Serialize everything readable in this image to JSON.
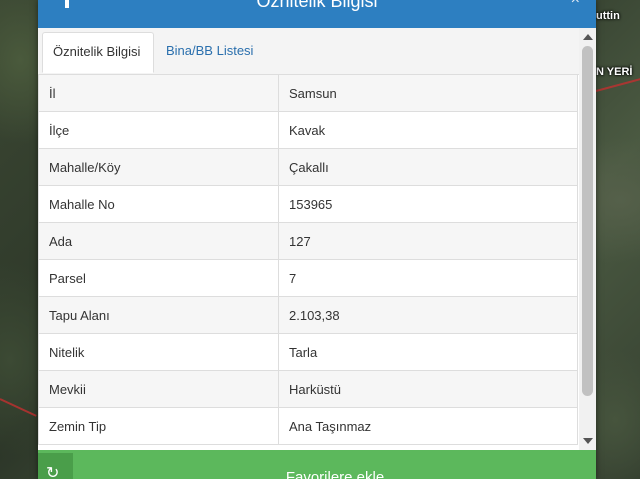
{
  "map": {
    "labels": [
      "uttin",
      "N YERİ"
    ]
  },
  "dialog": {
    "title": "Öznitelik Bilgisi",
    "close_symbol": "×",
    "tabs": [
      {
        "label": "Öznitelik Bilgisi",
        "active": true
      },
      {
        "label": "Bina/BB Listesi",
        "active": false
      }
    ],
    "rows": [
      {
        "key": "İl",
        "value": "Samsun"
      },
      {
        "key": "İlçe",
        "value": "Kavak"
      },
      {
        "key": "Mahalle/Köy",
        "value": "Çakallı"
      },
      {
        "key": "Mahalle No",
        "value": "153965"
      },
      {
        "key": "Ada",
        "value": "127"
      },
      {
        "key": "Parsel",
        "value": "7"
      },
      {
        "key": "Tapu Alanı",
        "value": "2.103,38"
      },
      {
        "key": "Nitelik",
        "value": "Tarla"
      },
      {
        "key": "Mevkii",
        "value": "Harküstü"
      },
      {
        "key": "Zemin Tip",
        "value": "Ana Taşınmaz"
      }
    ],
    "footer": {
      "button_label": "Favorilere ekle",
      "icon_symbol": "↻"
    }
  },
  "colors": {
    "header": "#2d7fc1",
    "tab_link": "#2a6fad",
    "footer": "#5cb85c"
  }
}
